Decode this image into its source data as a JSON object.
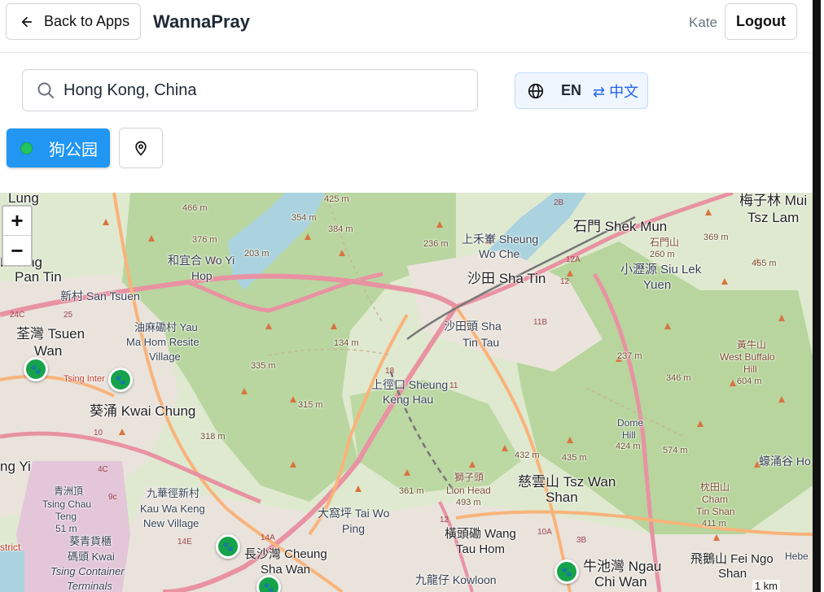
{
  "header": {
    "back_label": "Back to Apps",
    "app_title": "WannaPray",
    "user_name": "Kate",
    "logout_label": "Logout"
  },
  "search": {
    "value": "Hong Kong, China",
    "placeholder": ""
  },
  "language": {
    "current": "EN",
    "switch_label": "⇄ 中文"
  },
  "filters": [
    {
      "label": "狗公园",
      "active": true,
      "color": "#22c55e"
    }
  ],
  "colors": {
    "accent": "#2196f3",
    "marker": "#16a34a",
    "lang_bg": "#eff6ff",
    "lang_text": "#2563eb"
  },
  "map": {
    "zoom_in": "+",
    "zoom_out": "−",
    "scale": "1 km",
    "labels": {
      "lung": "Lung",
      "mui": "梅子林 Mui",
      "tsz_lam": "Tsz Lam",
      "e466": "466 m",
      "e425": "425 m",
      "e354": "354 m",
      "e384": "384 m",
      "e376": "376 m",
      "e203": "203 m",
      "e236": "236 m",
      "sheung_wo_che_1": "上禾輋 Sheung",
      "sheung_wo_che_2": "Wo Che",
      "shek_mun": "石門 Shek Mun",
      "shek_mun_cn": "石門山",
      "e260": "260 m",
      "e369": "369 m",
      "siu_lek_yuen_1": "小瀝源 Siu Lek",
      "siu_lek_yuen_2": "Yuen",
      "e455": "455 m",
      "kwong": "Kwong",
      "pan_tin": "Pan Tin",
      "wo_yi_hop_1": "和宜合 Wo Yi",
      "wo_yi_hop_2": "Hop",
      "sha_tin": "沙田 Sha Tin",
      "san_tsuen": "新村 San Tsuen",
      "tsuen_wan_1": "荃灣 Tsuen",
      "tsuen_wan_2": "Wan",
      "yau_ma_hom_1": "油麻磡村 Yau",
      "yau_ma_hom_2": "Ma Hom Resite",
      "yau_ma_hom_3": "Village",
      "sha_tin_tau_1": "沙田頭 Sha",
      "sha_tin_tau_2": "Tin Tau",
      "e134": "134 m",
      "e335": "335 m",
      "e237": "237 m",
      "west_buffalo_1": "黃牛山",
      "west_buffalo_2": "West Buffalo",
      "west_buffalo_3": "Hill",
      "e604": "604 m",
      "e346": "346 m",
      "tsing_interchange": "Tsing Inter",
      "keng_hau_1": "上徑口 Sheung",
      "keng_hau_2": "Keng Hau",
      "kwai_chung": "葵涌 Kwai Chung",
      "e315": "315 m",
      "e318": "318 m",
      "dome_hill_1": "Dome",
      "dome_hill_2": "Hill",
      "e424": "424 m",
      "e574": "574 m",
      "ng_yi": "ng Yi",
      "e432": "432 m",
      "e435": "435 m",
      "wong_ho": "蠔涌谷 Ho",
      "tsing_chau_teng_1": "青洲頂",
      "tsing_chau_teng_2": "Tsing Chau",
      "tsing_chau_teng_3": "Teng",
      "tsing_chau_teng_4": "51 m",
      "kau_wa_keng_1": "九華徑新村",
      "kau_wa_keng_2": "Kau Wa Keng",
      "kau_wa_keng_3": "New Village",
      "lion_head_1": "獅子頭",
      "lion_head_2": "Lion Head",
      "lion_head_3": "493 m",
      "e361": "361 m",
      "tsz_wan_shan_1": "慈雲山 Tsz Wan",
      "tsz_wan_shan_2": "Shan",
      "cham_tin_shan_1": "枕田山",
      "cham_tin_shan_2": "Cham",
      "cham_tin_shan_3": "Tin Shan",
      "cham_tin_shan_4": "411 m",
      "tai_wo_ping_1": "大窩坪 Tai Wo",
      "tai_wo_ping_2": "Ping",
      "container_1": "葵青貨櫃",
      "container_2": "碼頭 Kwai",
      "container_3": "Tsing Container",
      "container_4": "Terminals",
      "district": "strict",
      "wang_tau_hom_1": "橫頭磡 Wang",
      "wang_tau_hom_2": "Tau Hom",
      "cheung_sha_wan_1": "長沙灣 Cheung",
      "cheung_sha_wan_2": "Sha Wan",
      "kowloon": "九龍仔 Kowloon",
      "ngau_chi_wan_1": "牛池灣 Ngau",
      "ngau_chi_wan_2": "Chi Wan",
      "fei_ngo_1": "飛鵝山 Fei Ngo",
      "fei_ngo_2": "Shan",
      "hebe": "Hebe"
    }
  }
}
